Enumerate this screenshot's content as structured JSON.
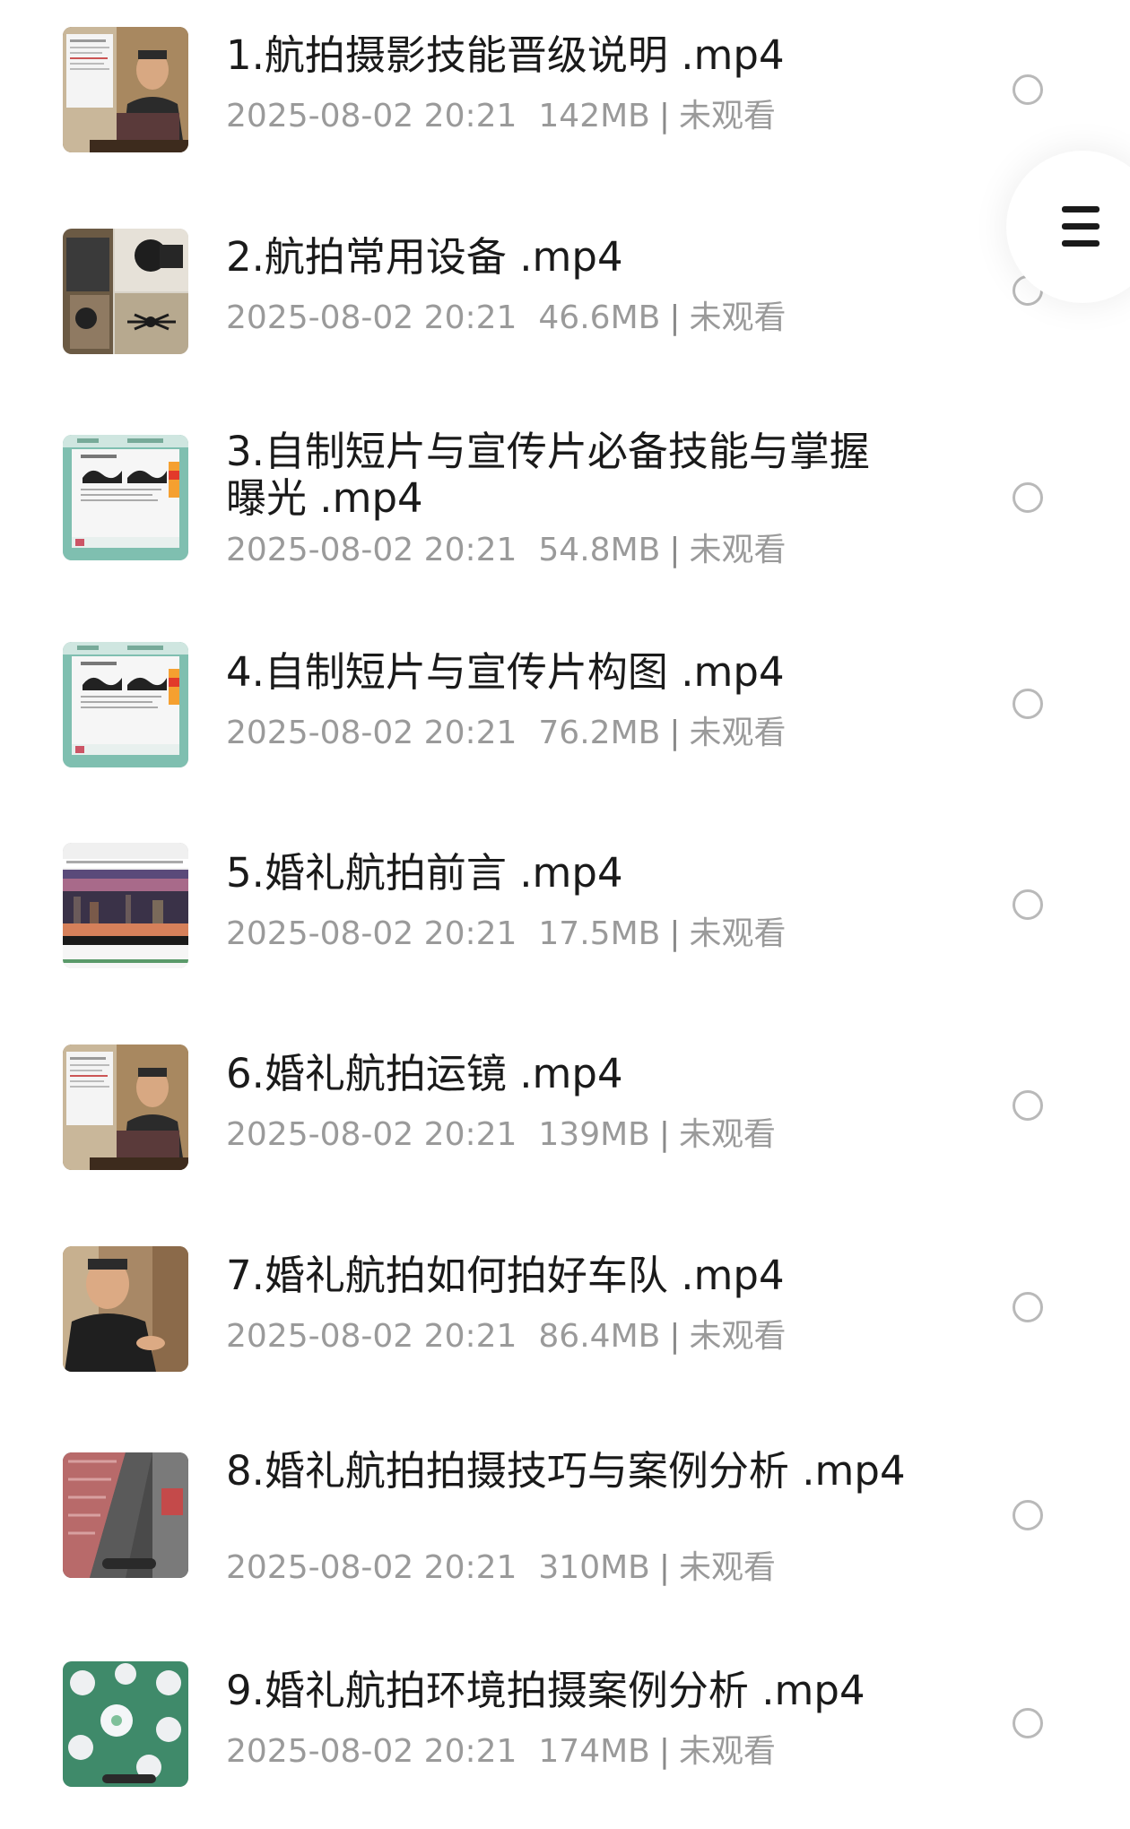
{
  "items": [
    {
      "title": "1.航拍摄影技能晋级说明 .mp4",
      "date": "2025-08-02 20:21",
      "size": "142MB",
      "status": "未观看",
      "thumb": "presenter-with-slide"
    },
    {
      "title": "2.航拍常用设备 .mp4",
      "date": "2025-08-02 20:21",
      "size": "46.6MB",
      "status": "未观看",
      "thumb": "equipment-collage"
    },
    {
      "title": "3.自制短片与宣传片必备技能与掌握曝光 .mp4",
      "date": "2025-08-02 20:21",
      "size": "54.8MB",
      "status": "未观看",
      "thumb": "slide-histogram"
    },
    {
      "title": "4.自制短片与宣传片构图 .mp4",
      "date": "2025-08-02 20:21",
      "size": "76.2MB",
      "status": "未观看",
      "thumb": "slide-histogram"
    },
    {
      "title": "5.婚礼航拍前言 .mp4",
      "date": "2025-08-02 20:21",
      "size": "17.5MB",
      "status": "未观看",
      "thumb": "city-skyline"
    },
    {
      "title": "6.婚礼航拍运镜 .mp4",
      "date": "2025-08-02 20:21",
      "size": "139MB",
      "status": "未观看",
      "thumb": "presenter-with-slide"
    },
    {
      "title": "7.婚礼航拍如何拍好车队 .mp4",
      "date": "2025-08-02 20:21",
      "size": "86.4MB",
      "status": "未观看",
      "thumb": "presenter-closeup"
    },
    {
      "title": "8.婚礼航拍拍摄技巧与案例分析 .mp4",
      "date": "2025-08-02 20:21",
      "size": "310MB",
      "status": "未观看",
      "thumb": "aerial-street"
    },
    {
      "title": "9.婚礼航拍环境拍摄案例分析 .mp4",
      "date": "2025-08-02 20:21",
      "size": "174MB",
      "status": "未观看",
      "thumb": "aerial-banquet"
    }
  ],
  "menu_button": {
    "icon": "hamburger-menu-icon"
  },
  "colors": {
    "title": "#1a1a1a",
    "meta": "#9a9a9a",
    "radio_border": "#b9b9b9",
    "background": "#ffffff"
  }
}
